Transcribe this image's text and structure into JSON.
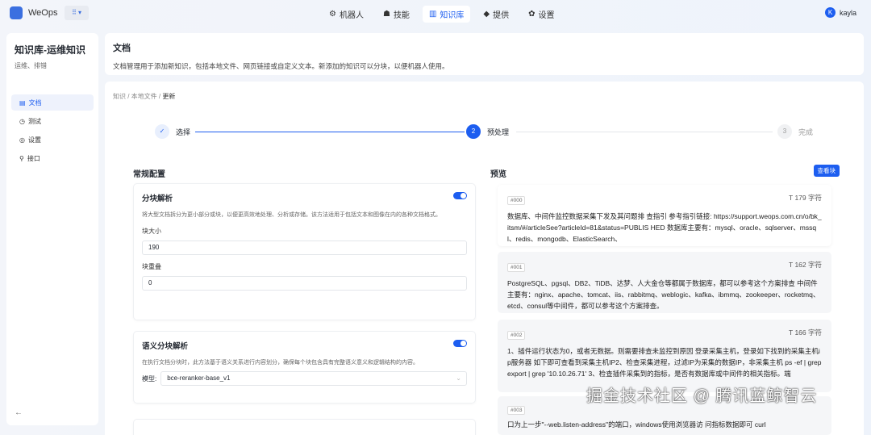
{
  "app": {
    "name": "WeOps",
    "switcher": "⠿ ▾"
  },
  "nav": [
    {
      "icon": "robot-icon",
      "glyph": "⚙",
      "label": "机器人"
    },
    {
      "icon": "skill-icon",
      "glyph": "☗",
      "label": "技能"
    },
    {
      "icon": "knowledge-icon",
      "glyph": "▥",
      "label": "知识库",
      "active": true
    },
    {
      "icon": "provider-icon",
      "glyph": "◆",
      "label": "提供"
    },
    {
      "icon": "settings-icon",
      "glyph": "✿",
      "label": "设置"
    }
  ],
  "user": {
    "initial": "K",
    "name": "kayla"
  },
  "sidebar": {
    "title": "知识库-运维知识",
    "subtitle": "运维、排错",
    "items": [
      {
        "glyph": "▤",
        "label": "文档"
      },
      {
        "glyph": "◷",
        "label": "测试"
      },
      {
        "glyph": "◎",
        "label": "设置"
      },
      {
        "glyph": "⚲",
        "label": "接口"
      }
    ],
    "collapse": "←"
  },
  "header": {
    "title": "文档",
    "description": "文档管理用于添加新知识，包括本地文件、网页链接或自定义文本。新添加的知识可以分块，以便机器人使用。"
  },
  "breadcrumb": [
    "知识",
    "本地文件",
    "更新"
  ],
  "steps": [
    {
      "num": "✓",
      "label": "选择"
    },
    {
      "num": "2",
      "label": "预处理"
    },
    {
      "num": "3",
      "label": "完成"
    }
  ],
  "config": {
    "title": "常规配置",
    "chunk": {
      "title": "分块解析",
      "enabled": true,
      "description": "将大型文档拆分为更小部分或块，以便更高效地处理、分析或存储。该方法适用于包括文本和图像在内的各种文档格式。",
      "size_label": "块大小",
      "size": "190",
      "overlap_label": "块重叠",
      "overlap": "0"
    },
    "semantic": {
      "title": "语义分块解析",
      "enabled": true,
      "description": "在执行文档分块时，此方法基于语义关系进行内容划分，确保每个块包含具有完整语义意义和逻辑结构的内容。",
      "model_label": "模型:",
      "model": "bce-reranker-base_v1"
    }
  },
  "preview": {
    "title": "预览",
    "button": "查看块",
    "chunks": [
      {
        "id": "#000",
        "count": "179 字符",
        "text": "数据库、中间件监控数据采集下发及其问题排 查指引 参考指引链接: https://support.weops.com.cn/o/bk_itsm/#/articleSee?articleId=81&status=PUBLIS HED 数据库主要有：mysql、oracle、sqlserver、mssql、redis、mongodb、ElasticSearch、"
      },
      {
        "id": "#001",
        "count": "162 字符",
        "text": "PostgreSQL、pgsql、DB2、TiDB、达梦、人大金仓等都属于数据库，都可以参考这个方案排查 中间件主要有：nginx、apache、tomcat、iis、rabbitmq、weblogic、kafka、ibmmq、zookeeper、rocketmq、etcd、consul等中间件，都可以参考这个方案排查。"
      },
      {
        "id": "#002",
        "count": "166 字符",
        "text": "1、插件运行状态为0，或者无数据。则需要排查未监控到原因 登录采集主机，登录如下找到的采集主机ip服务器 如下即可查看到采集主机IP2、检查采集进程，过滤IP为采集的数据IP，非采集主机 ps -ef | grep export | grep '10.10.26.71' 3、检查插件采集到的指标，是否有数据库或中间件的相关指标。端"
      },
      {
        "id": "#003",
        "count": "",
        "text": "口为上一步\"--web.listen-address\"的端口，windows使用浏览器访 问指标数据即可 curl"
      }
    ]
  },
  "watermark": "掘金技术社区 @ 腾讯蓝鲸智云"
}
